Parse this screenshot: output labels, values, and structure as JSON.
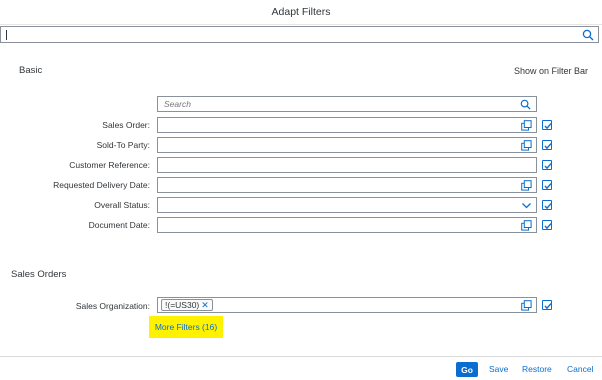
{
  "dialog": {
    "title": "Adapt Filters"
  },
  "global_search": {
    "value": ""
  },
  "basic": {
    "title": "Basic",
    "show_on_filter_bar": "Show on Filter Bar",
    "search_placeholder": "Search",
    "fields": [
      {
        "label": "Sales Order:",
        "icon": "value-help-icon",
        "checked": true
      },
      {
        "label": "Sold-To Party:",
        "icon": "value-help-icon",
        "checked": true
      },
      {
        "label": "Customer Reference:",
        "icon": "",
        "checked": true
      },
      {
        "label": "Requested Delivery Date:",
        "icon": "value-help-icon",
        "checked": true
      },
      {
        "label": "Overall Status:",
        "icon": "chevron-down-icon",
        "checked": true
      },
      {
        "label": "Document Date:",
        "icon": "value-help-icon",
        "checked": true
      }
    ]
  },
  "sales_orders": {
    "title": "Sales Orders",
    "field_label": "Sales Organization:",
    "token": "!(=US30)",
    "more_filters": "More Filters (16)",
    "checked": true
  },
  "footer": {
    "go": "Go",
    "save": "Save",
    "restore": "Restore",
    "cancel": "Cancel"
  },
  "colors": {
    "accent": "#0a6ed1",
    "highlight": "#fff200"
  }
}
